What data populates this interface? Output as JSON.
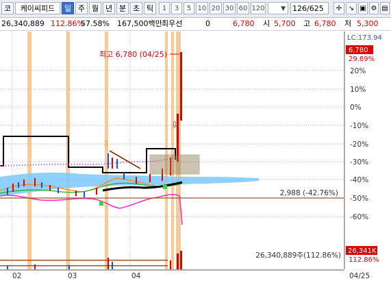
{
  "toolbar": {
    "buttons": [
      "코",
      "케이씨피드",
      "일",
      "주",
      "월",
      "년",
      "분",
      "초",
      "틱"
    ],
    "periods": [
      "1",
      "3",
      "5",
      "10",
      "20",
      "30",
      "60",
      "120"
    ],
    "count_value": "126",
    "count_total": "/625"
  },
  "info": {
    "volume": "26,340,889",
    "volume_ratio": "112.86%",
    "turnover": "57.58%",
    "amount": "167,500백만",
    "priority": "최우선",
    "priority_value": "0",
    "price": "6,780",
    "open_label": "시",
    "open_value": "5,700",
    "high_label": "고",
    "high_value": "6,780",
    "low_label": "저",
    "low_value": "5,300"
  },
  "chart": {
    "lc_label": "LC:173.94",
    "price_badge": "6,780",
    "pct_badge": "29.89%",
    "peak_annotation": "최고 6,780 (04/25)",
    "ref_line_label": "2,988 (-42.76%)",
    "volume_label": "26,340,889주(112.86%)",
    "volume_badge": "26,341K",
    "volume_pct": "112.86%",
    "pct_ticks": [
      "20%",
      "10%",
      "0%",
      "-10%",
      "-20%",
      "-30%",
      "-40%",
      "-50%",
      "-60%"
    ],
    "x_labels": [
      "02",
      "03",
      "04",
      "04/25"
    ],
    "colors": {
      "up": "#e00000",
      "down": "#1a4fd6",
      "highlight_band": "#f7b775",
      "ma_black": "#000000",
      "ma_pink": "#ff22cc",
      "cloud": "#7cc8ff",
      "ref_line": "#a05020"
    }
  }
}
